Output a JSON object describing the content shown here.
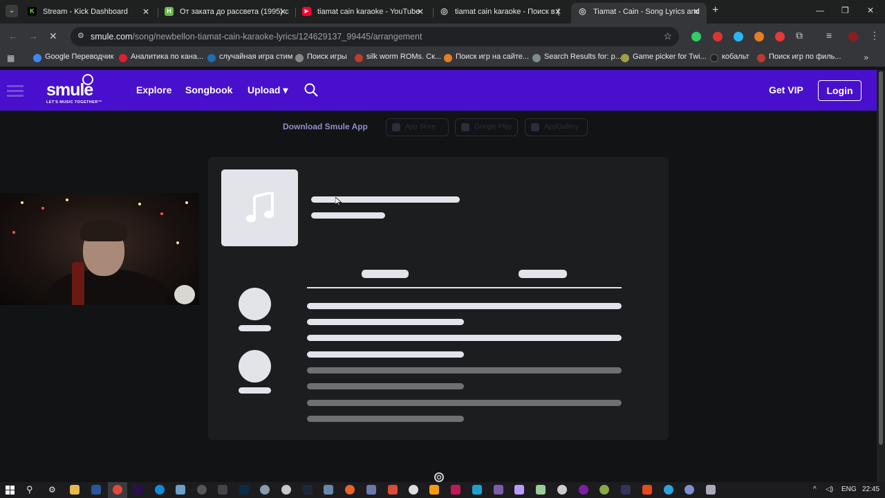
{
  "browser": {
    "tabs": [
      {
        "title": "Stream - Kick Dashboard",
        "icon": "kick-icon",
        "color": "#53fc18",
        "glyph": "K",
        "active": false
      },
      {
        "title": "От заката до рассвета (1995) с",
        "icon": "hdrezka-icon",
        "color": "#66bb44",
        "glyph": "H",
        "active": false
      },
      {
        "title": "tiamat cain karaoke - YouTube",
        "icon": "youtube-icon",
        "color": "#ff0033",
        "glyph": "▶",
        "active": false
      },
      {
        "title": "tiamat cain karaoke - Поиск в (",
        "icon": "search-engine-icon",
        "color": "#9aa0a6",
        "glyph": "◎",
        "active": false
      },
      {
        "title": "Tiamat - Cain - Song Lyrics and",
        "icon": "smule-tab-icon",
        "color": "#9aa0a6",
        "glyph": "◎",
        "active": true
      }
    ],
    "url_domain": "smule.com",
    "url_path": "/song/newbellon-tiamat-cain-karaoke-lyrics/124629137_99445/arrangement",
    "bookmarks": [
      {
        "label": "Google Переводчик",
        "color": "#4285f4"
      },
      {
        "label": "Аналитика по кана...",
        "color": "#e02030"
      },
      {
        "label": "случайная игра стим",
        "color": "#1b6fb5"
      },
      {
        "label": "Поиск игры",
        "color": "#888888"
      },
      {
        "label": "silk worm ROMs. Ск...",
        "color": "#c0392b"
      },
      {
        "label": "Поиск игр на сайте...",
        "color": "#e67e22"
      },
      {
        "label": "Search Results for: p...",
        "color": "#7f8c8d"
      },
      {
        "label": "Game picker for Twi...",
        "color": "#a0a040"
      },
      {
        "label": "кобальт",
        "color": "#222222"
      },
      {
        "label": "Поиск игр по филь...",
        "color": "#c0392b"
      }
    ]
  },
  "smule": {
    "logo_text": "smule",
    "logo_tagline": "LET'S MUSIC TOGETHER™",
    "nav": {
      "explore": "Explore",
      "songbook": "Songbook",
      "upload": "Upload",
      "upload_caret": "▾"
    },
    "get_vip": "Get VIP",
    "login": "Login",
    "download_app": "Download Smule App",
    "stores": [
      "App Store",
      "Google Play",
      "AppGallery"
    ]
  },
  "taskbar": {
    "language": "ENG",
    "time": "22:45"
  },
  "colors": {
    "smule_purple": "#4810cc",
    "skeleton": "#e2e4ea",
    "card_bg": "#1b1d1f"
  }
}
